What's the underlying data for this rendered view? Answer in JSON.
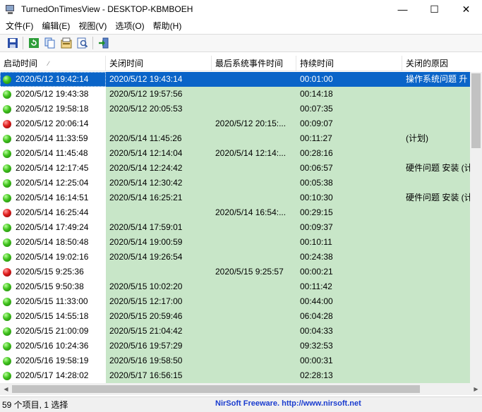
{
  "window": {
    "title": "TurnedOnTimesView  -  DESKTOP-KBMBOEH",
    "minimize": "—",
    "maximize": "☐",
    "close": "✕"
  },
  "menu": [
    "文件(F)",
    "编辑(E)",
    "视图(V)",
    "选项(O)",
    "帮助(H)"
  ],
  "toolbar": {
    "icons": [
      "save-icon",
      "refresh-icon",
      "copy-icon",
      "properties-icon",
      "find-icon",
      "exit-icon"
    ]
  },
  "columns": [
    "启动时间",
    "关闭时间",
    "最后系统事件时间",
    "持续时间",
    "关闭的原因"
  ],
  "sort_indicator": "∕",
  "rows": [
    {
      "status": "green",
      "start": "2020/5/12 19:42:14",
      "end": "2020/5/12 19:43:14",
      "last_event": "",
      "duration": "00:01:00",
      "reason": "操作系统问题 升"
    },
    {
      "status": "green",
      "start": "2020/5/12 19:43:38",
      "end": "2020/5/12 19:57:56",
      "last_event": "",
      "duration": "00:14:18",
      "reason": ""
    },
    {
      "status": "green",
      "start": "2020/5/12 19:58:18",
      "end": "2020/5/12 20:05:53",
      "last_event": "",
      "duration": "00:07:35",
      "reason": ""
    },
    {
      "status": "red",
      "start": "2020/5/12 20:06:14",
      "end": "",
      "last_event": "2020/5/12 20:15:...",
      "duration": "00:09:07",
      "reason": ""
    },
    {
      "status": "green",
      "start": "2020/5/14 11:33:59",
      "end": "2020/5/14 11:45:26",
      "last_event": "",
      "duration": "00:11:27",
      "reason": " (计划)"
    },
    {
      "status": "green",
      "start": "2020/5/14 11:45:48",
      "end": "2020/5/14 12:14:04",
      "last_event": "2020/5/14 12:14:...",
      "duration": "00:28:16",
      "reason": ""
    },
    {
      "status": "green",
      "start": "2020/5/14 12:17:45",
      "end": "2020/5/14 12:24:42",
      "last_event": "",
      "duration": "00:06:57",
      "reason": "硬件问题 安装 (计"
    },
    {
      "status": "green",
      "start": "2020/5/14 12:25:04",
      "end": "2020/5/14 12:30:42",
      "last_event": "",
      "duration": "00:05:38",
      "reason": ""
    },
    {
      "status": "green",
      "start": "2020/5/14 16:14:51",
      "end": "2020/5/14 16:25:21",
      "last_event": "",
      "duration": "00:10:30",
      "reason": "硬件问题 安装 (计"
    },
    {
      "status": "red",
      "start": "2020/5/14 16:25:44",
      "end": "",
      "last_event": "2020/5/14 16:54:...",
      "duration": "00:29:15",
      "reason": ""
    },
    {
      "status": "green",
      "start": "2020/5/14 17:49:24",
      "end": "2020/5/14 17:59:01",
      "last_event": "",
      "duration": "00:09:37",
      "reason": ""
    },
    {
      "status": "green",
      "start": "2020/5/14 18:50:48",
      "end": "2020/5/14 19:00:59",
      "last_event": "",
      "duration": "00:10:11",
      "reason": ""
    },
    {
      "status": "green",
      "start": "2020/5/14 19:02:16",
      "end": "2020/5/14 19:26:54",
      "last_event": "",
      "duration": "00:24:38",
      "reason": ""
    },
    {
      "status": "red",
      "start": "2020/5/15 9:25:36",
      "end": "",
      "last_event": "2020/5/15 9:25:57",
      "duration": "00:00:21",
      "reason": ""
    },
    {
      "status": "green",
      "start": "2020/5/15 9:50:38",
      "end": "2020/5/15 10:02:20",
      "last_event": "",
      "duration": "00:11:42",
      "reason": ""
    },
    {
      "status": "green",
      "start": "2020/5/15 11:33:00",
      "end": "2020/5/15 12:17:00",
      "last_event": "",
      "duration": "00:44:00",
      "reason": ""
    },
    {
      "status": "green",
      "start": "2020/5/15 14:55:18",
      "end": "2020/5/15 20:59:46",
      "last_event": "",
      "duration": "06:04:28",
      "reason": ""
    },
    {
      "status": "green",
      "start": "2020/5/15 21:00:09",
      "end": "2020/5/15 21:04:42",
      "last_event": "",
      "duration": "00:04:33",
      "reason": ""
    },
    {
      "status": "green",
      "start": "2020/5/16 10:24:36",
      "end": "2020/5/16 19:57:29",
      "last_event": "",
      "duration": "09:32:53",
      "reason": ""
    },
    {
      "status": "green",
      "start": "2020/5/16 19:58:19",
      "end": "2020/5/16 19:58:50",
      "last_event": "",
      "duration": "00:00:31",
      "reason": ""
    },
    {
      "status": "green",
      "start": "2020/5/17 14:28:02",
      "end": "2020/5/17 16:56:15",
      "last_event": "",
      "duration": "02:28:13",
      "reason": ""
    }
  ],
  "selected_row": 0,
  "status": {
    "summary": "59 个项目, 1 选择",
    "link": "NirSoft Freeware.  http://www.nirsoft.net"
  },
  "colors": {
    "row_bg": "#c8e6c8",
    "selected_bg": "#0a64c8",
    "link": "#1a3ccf"
  }
}
